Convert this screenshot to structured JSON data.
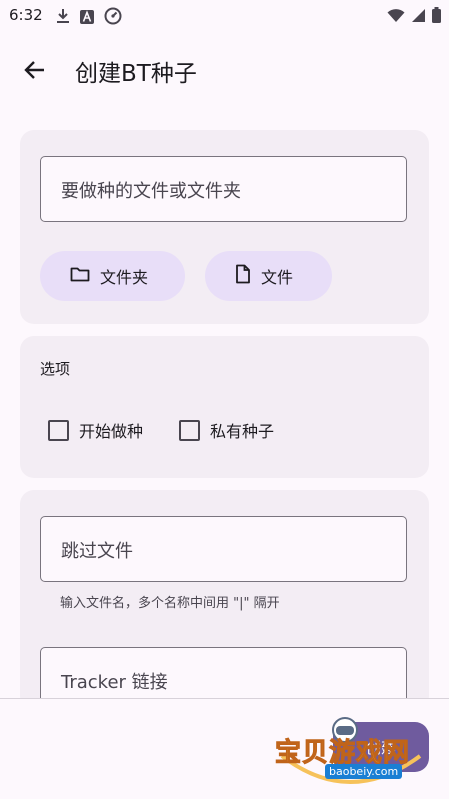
{
  "status_bar": {
    "time": "6:32",
    "icons": [
      "download-icon",
      "font-a-icon",
      "speedometer-icon"
    ],
    "right_icons": [
      "wifi-icon",
      "signal-icon",
      "battery-icon"
    ]
  },
  "app_bar": {
    "title": "创建BT种子",
    "back_icon": "arrow-left-icon"
  },
  "source_card": {
    "path_field": {
      "placeholder": "要做种的文件或文件夹",
      "value": ""
    },
    "folder_button": {
      "label": "文件夹",
      "icon": "folder-icon"
    },
    "file_button": {
      "label": "文件",
      "icon": "file-icon"
    }
  },
  "options_card": {
    "title": "选项",
    "checkboxes": [
      {
        "label": "开始做种",
        "checked": false
      },
      {
        "label": "私有种子",
        "checked": false
      }
    ]
  },
  "details_card": {
    "skip_field": {
      "placeholder": "跳过文件",
      "helper": "输入文件名，多个名称中间用 \"|\" 隔开"
    },
    "tracker_field": {
      "placeholder": "Tracker 链接"
    }
  },
  "fab": {
    "label": "创建"
  },
  "watermark": {
    "text": "宝贝游戏网",
    "url": "baobeiy.com"
  },
  "colors": {
    "background": "#fdf8fd",
    "card": "#f3edf4",
    "tonal_button": "#e8def8",
    "primary": "#6f5b9e",
    "outline": "#79747e"
  }
}
